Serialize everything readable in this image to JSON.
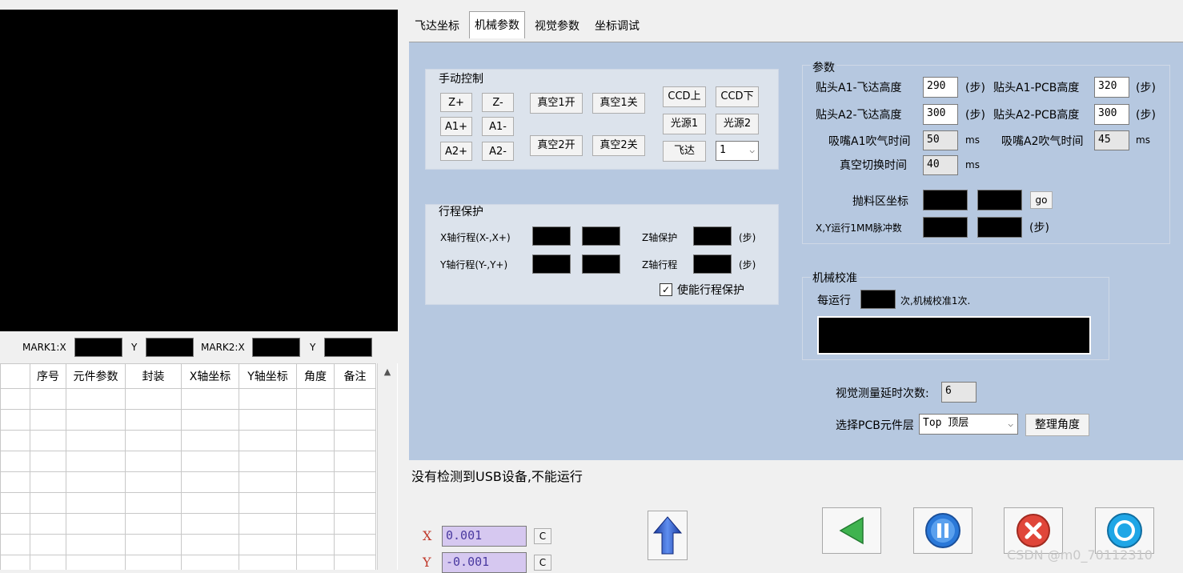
{
  "tabs": [
    "飞达坐标",
    "机械参数",
    "视觉参数",
    "坐标调试"
  ],
  "mark": {
    "mark1_x_label": "MARK1:X",
    "y_label": "Y",
    "mark2_x_label": "MARK2:X"
  },
  "table": {
    "headers": [
      "序号",
      "元件参数",
      "封装",
      "X轴坐标",
      "Y轴坐标",
      "角度",
      "备注"
    ]
  },
  "manual": {
    "title": "手动控制",
    "z_plus": "Z+",
    "z_minus": "Z-",
    "a1_plus": "A1+",
    "a1_minus": "A1-",
    "a2_plus": "A2+",
    "a2_minus": "A2-",
    "vac1_on": "真空1开",
    "vac1_off": "真空1关",
    "vac2_on": "真空2开",
    "vac2_off": "真空2关",
    "ccd_up": "CCD上",
    "ccd_down": "CCD下",
    "light1": "光源1",
    "light2": "光源2",
    "feeder": "飞达",
    "feeder_select": "1"
  },
  "travel": {
    "title": "行程保护",
    "x_travel": "X轴行程(X-,X+)",
    "y_travel": "Y轴行程(Y-,Y+)",
    "z_protect": "Z轴保护",
    "z_travel": "Z轴行程",
    "unit_step": "(步)",
    "enable_label": "使能行程保护"
  },
  "params": {
    "title": "参数",
    "a1_feeder_label": "贴头A1-飞达高度",
    "a1_feeder_value": "290",
    "a1_pcb_label": "贴头A1-PCB高度",
    "a1_pcb_value": "320",
    "a2_feeder_label": "贴头A2-飞达高度",
    "a2_feeder_value": "300",
    "a2_pcb_label": "贴头A2-PCB高度",
    "a2_pcb_value": "300",
    "unit_step": "(步)",
    "nozzle_a1_label": "吸嘴A1吹气时间",
    "nozzle_a1_value": "50",
    "nozzle_a2_label": "吸嘴A2吹气时间",
    "nozzle_a2_value": "45",
    "ms": "ms",
    "vac_switch_label": "真空切换时间",
    "vac_switch_value": "40",
    "throw_label": "抛料区坐标",
    "go_label": "go",
    "pulse_label": "X,Y运行1MM脉冲数"
  },
  "calib": {
    "title": "机械校准",
    "every_run": "每运行",
    "suffix": "次,机械校准1次."
  },
  "vision": {
    "delay_label": "视觉测量延时次数:",
    "delay_value": "6",
    "layer_label": "选择PCB元件层",
    "layer_value": "Top 顶层",
    "sort_angle": "整理角度"
  },
  "status": {
    "message": "没有检测到USB设备,不能运行"
  },
  "coords": {
    "x_label": "X",
    "x_value": "0.001",
    "y_label": "Y",
    "y_value": "-0.001",
    "c_label": "C"
  },
  "watermark": "CSDN @m0_70112310",
  "colors": {
    "panel": "#b6c8e0",
    "group": "#dce3ec",
    "green": "#3fb34f",
    "blue": "#2a78d8",
    "red": "#e0463a",
    "cyan": "#1fa6e6"
  }
}
